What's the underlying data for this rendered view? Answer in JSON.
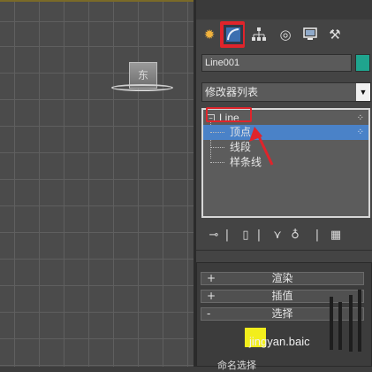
{
  "viewport": {
    "viewcube_label": "东"
  },
  "command_panel": {
    "tabs": [
      {
        "name": "create-tab",
        "icon": "sun-icon",
        "glyph": "✹"
      },
      {
        "name": "modify-tab",
        "icon": "modify-curve-icon",
        "glyph": "◜"
      },
      {
        "name": "hierarchy-tab",
        "icon": "hierarchy-icon",
        "glyph": "⌥"
      },
      {
        "name": "motion-tab",
        "icon": "motion-icon",
        "glyph": "◎"
      },
      {
        "name": "display-tab",
        "icon": "monitor-icon",
        "glyph": "▣"
      },
      {
        "name": "utilities-tab",
        "icon": "hammer-icon",
        "glyph": "⚒"
      }
    ],
    "object_name": "Line001",
    "object_color": "#1fa48e",
    "modifier_list_label": "修改器列表",
    "stack": {
      "root": "Line",
      "items": [
        "顶点",
        "线段",
        "样条线"
      ],
      "selected_index": 0
    },
    "stack_tools": [
      "pin-icon",
      "show-end-result-icon",
      "make-unique-icon",
      "remove-modifier-icon",
      "configure-sets-icon"
    ],
    "rollouts": [
      {
        "sign": "+",
        "title": "渲染"
      },
      {
        "sign": "+",
        "title": "插值"
      },
      {
        "sign": "-",
        "title": "选择"
      }
    ],
    "footer_text": "命名选择",
    "watermark": "jingyan.baic"
  },
  "accent_colors": {
    "highlight_red": "#e0242b",
    "selection_blue": "#4a82c8"
  }
}
